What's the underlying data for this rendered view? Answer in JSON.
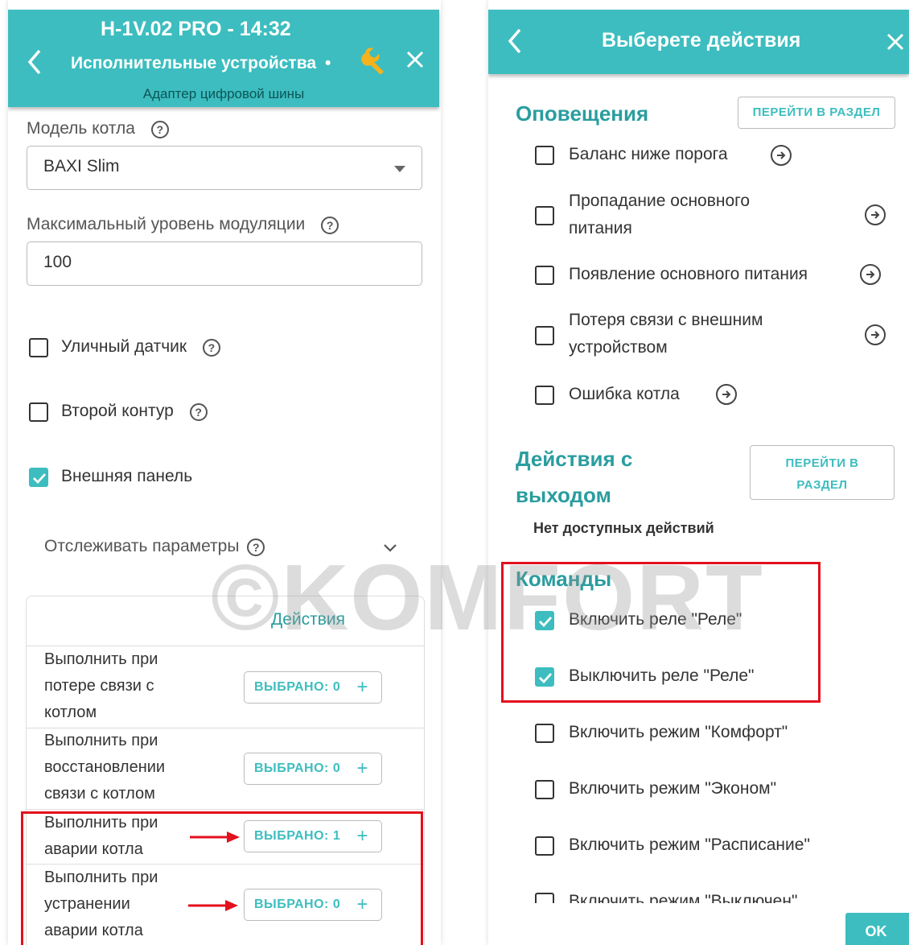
{
  "left": {
    "header": {
      "title": "H-1V.02 PRO - 14:32",
      "subtitle": "Исполнительные устройства",
      "dot": "•",
      "caption": "Адаптер цифровой шины"
    },
    "boiler_model": {
      "label": "Модель котла",
      "value": "BAXI Slim"
    },
    "max_modulation": {
      "label": "Максимальный уровень модуляции",
      "value": "100"
    },
    "checkboxes": [
      {
        "label": "Уличный датчик",
        "checked": false
      },
      {
        "label": "Второй контур",
        "checked": false
      },
      {
        "label": "Внешняя панель",
        "checked": true
      }
    ],
    "track_params": {
      "label": "Отслеживать параметры"
    },
    "actions": {
      "header": "Действия",
      "rows": [
        {
          "lines": [
            "Выполнить при",
            "потере связи с",
            "котлом"
          ],
          "button": "ВЫБРАНО: 0"
        },
        {
          "lines": [
            "Выполнить при",
            "восстановлении",
            "связи с котлом"
          ],
          "button": "ВЫБРАНО: 0"
        },
        {
          "lines": [
            "Выполнить при",
            "аварии котла"
          ],
          "button": "ВЫБРАНО: 1"
        },
        {
          "lines": [
            "Выполнить при",
            "устранении",
            "аварии котла"
          ],
          "button": "ВЫБРАНО: 0"
        }
      ],
      "plus": "+"
    },
    "help": "?"
  },
  "right": {
    "header": {
      "title": "Выберете действия"
    },
    "notifications": {
      "title": "Оповещения",
      "goto": "ПЕРЕЙТИ В РАЗДЕЛ",
      "items": [
        {
          "lines": [
            "Баланс ниже порога"
          ],
          "checked": false
        },
        {
          "lines": [
            "Пропадание основного",
            "питания"
          ],
          "checked": false
        },
        {
          "lines": [
            "Появление основного питания"
          ],
          "checked": false
        },
        {
          "lines": [
            "Потеря связи с внешним",
            "устройством"
          ],
          "checked": false
        },
        {
          "lines": [
            "Ошибка котла"
          ],
          "checked": false
        }
      ]
    },
    "output_actions": {
      "title_lines": [
        "Действия с",
        "выходом"
      ],
      "goto_lines": [
        "ПЕРЕЙТИ В",
        "РАЗДЕЛ"
      ],
      "empty": "Нет доступных действий"
    },
    "commands": {
      "title": "Команды",
      "items": [
        {
          "label": "Включить реле \"Реле\"",
          "checked": true
        },
        {
          "label": "Выключить реле \"Реле\"",
          "checked": true
        },
        {
          "label": "Включить режим \"Комфорт\"",
          "checked": false
        },
        {
          "label": "Включить режим \"Эконом\"",
          "checked": false
        },
        {
          "label": "Включить режим \"Расписание\"",
          "checked": false
        },
        {
          "label": "Включить режим \"Выключен\"",
          "checked": false
        }
      ]
    },
    "ok": "OK"
  },
  "watermark": "©KOMFORT",
  "colors": {
    "accent": "#3dbdbf",
    "accent_dark": "#2a9d9f",
    "highlight": "#e3101d"
  }
}
